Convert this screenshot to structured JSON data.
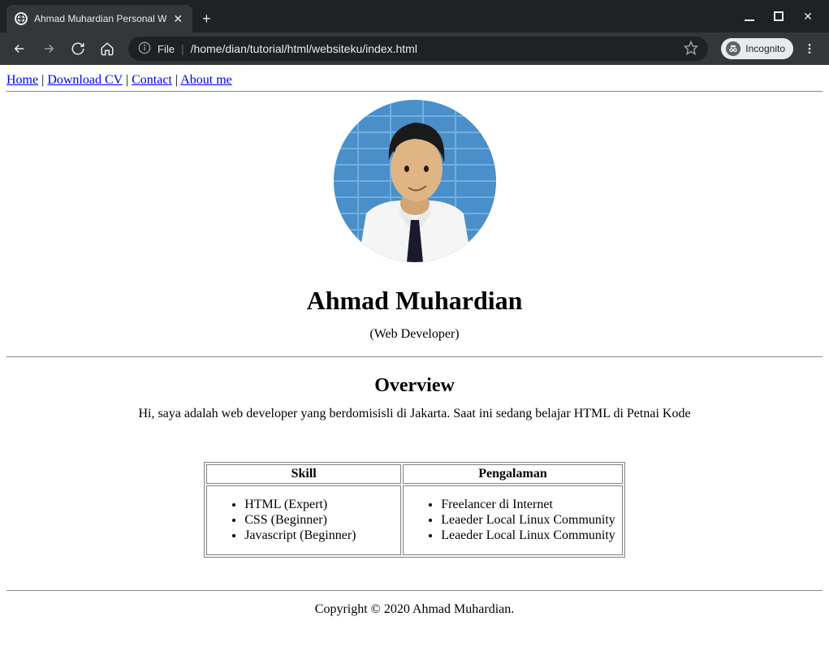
{
  "browser": {
    "tab_title": "Ahmad Muhardian Personal W",
    "url_scheme": "File",
    "url_path": "/home/dian/tutorial/html/websiteku/index.html",
    "incognito_label": "Incognito"
  },
  "nav": {
    "items": [
      {
        "label": "Home"
      },
      {
        "label": "Download CV"
      },
      {
        "label": "Contact"
      },
      {
        "label": "About me"
      }
    ],
    "separator": " | "
  },
  "profile": {
    "name": "Ahmad Muhardian",
    "role": "(Web Developer)"
  },
  "overview": {
    "heading": "Overview",
    "text": "Hi, saya adalah web developer yang berdomisisli di Jakarta. Saat ini sedang belajar HTML di Petnai Kode"
  },
  "table": {
    "headers": {
      "skill": "Skill",
      "experience": "Pengalaman"
    },
    "skills": [
      "HTML (Expert)",
      "CSS (Beginner)",
      "Javascript (Beginner)"
    ],
    "experience": [
      "Freelancer di Internet",
      "Leaeder Local Linux Community",
      "Leaeder Local Linux Community"
    ]
  },
  "footer": {
    "text": "Copyright © 2020 Ahmad Muhardian."
  }
}
